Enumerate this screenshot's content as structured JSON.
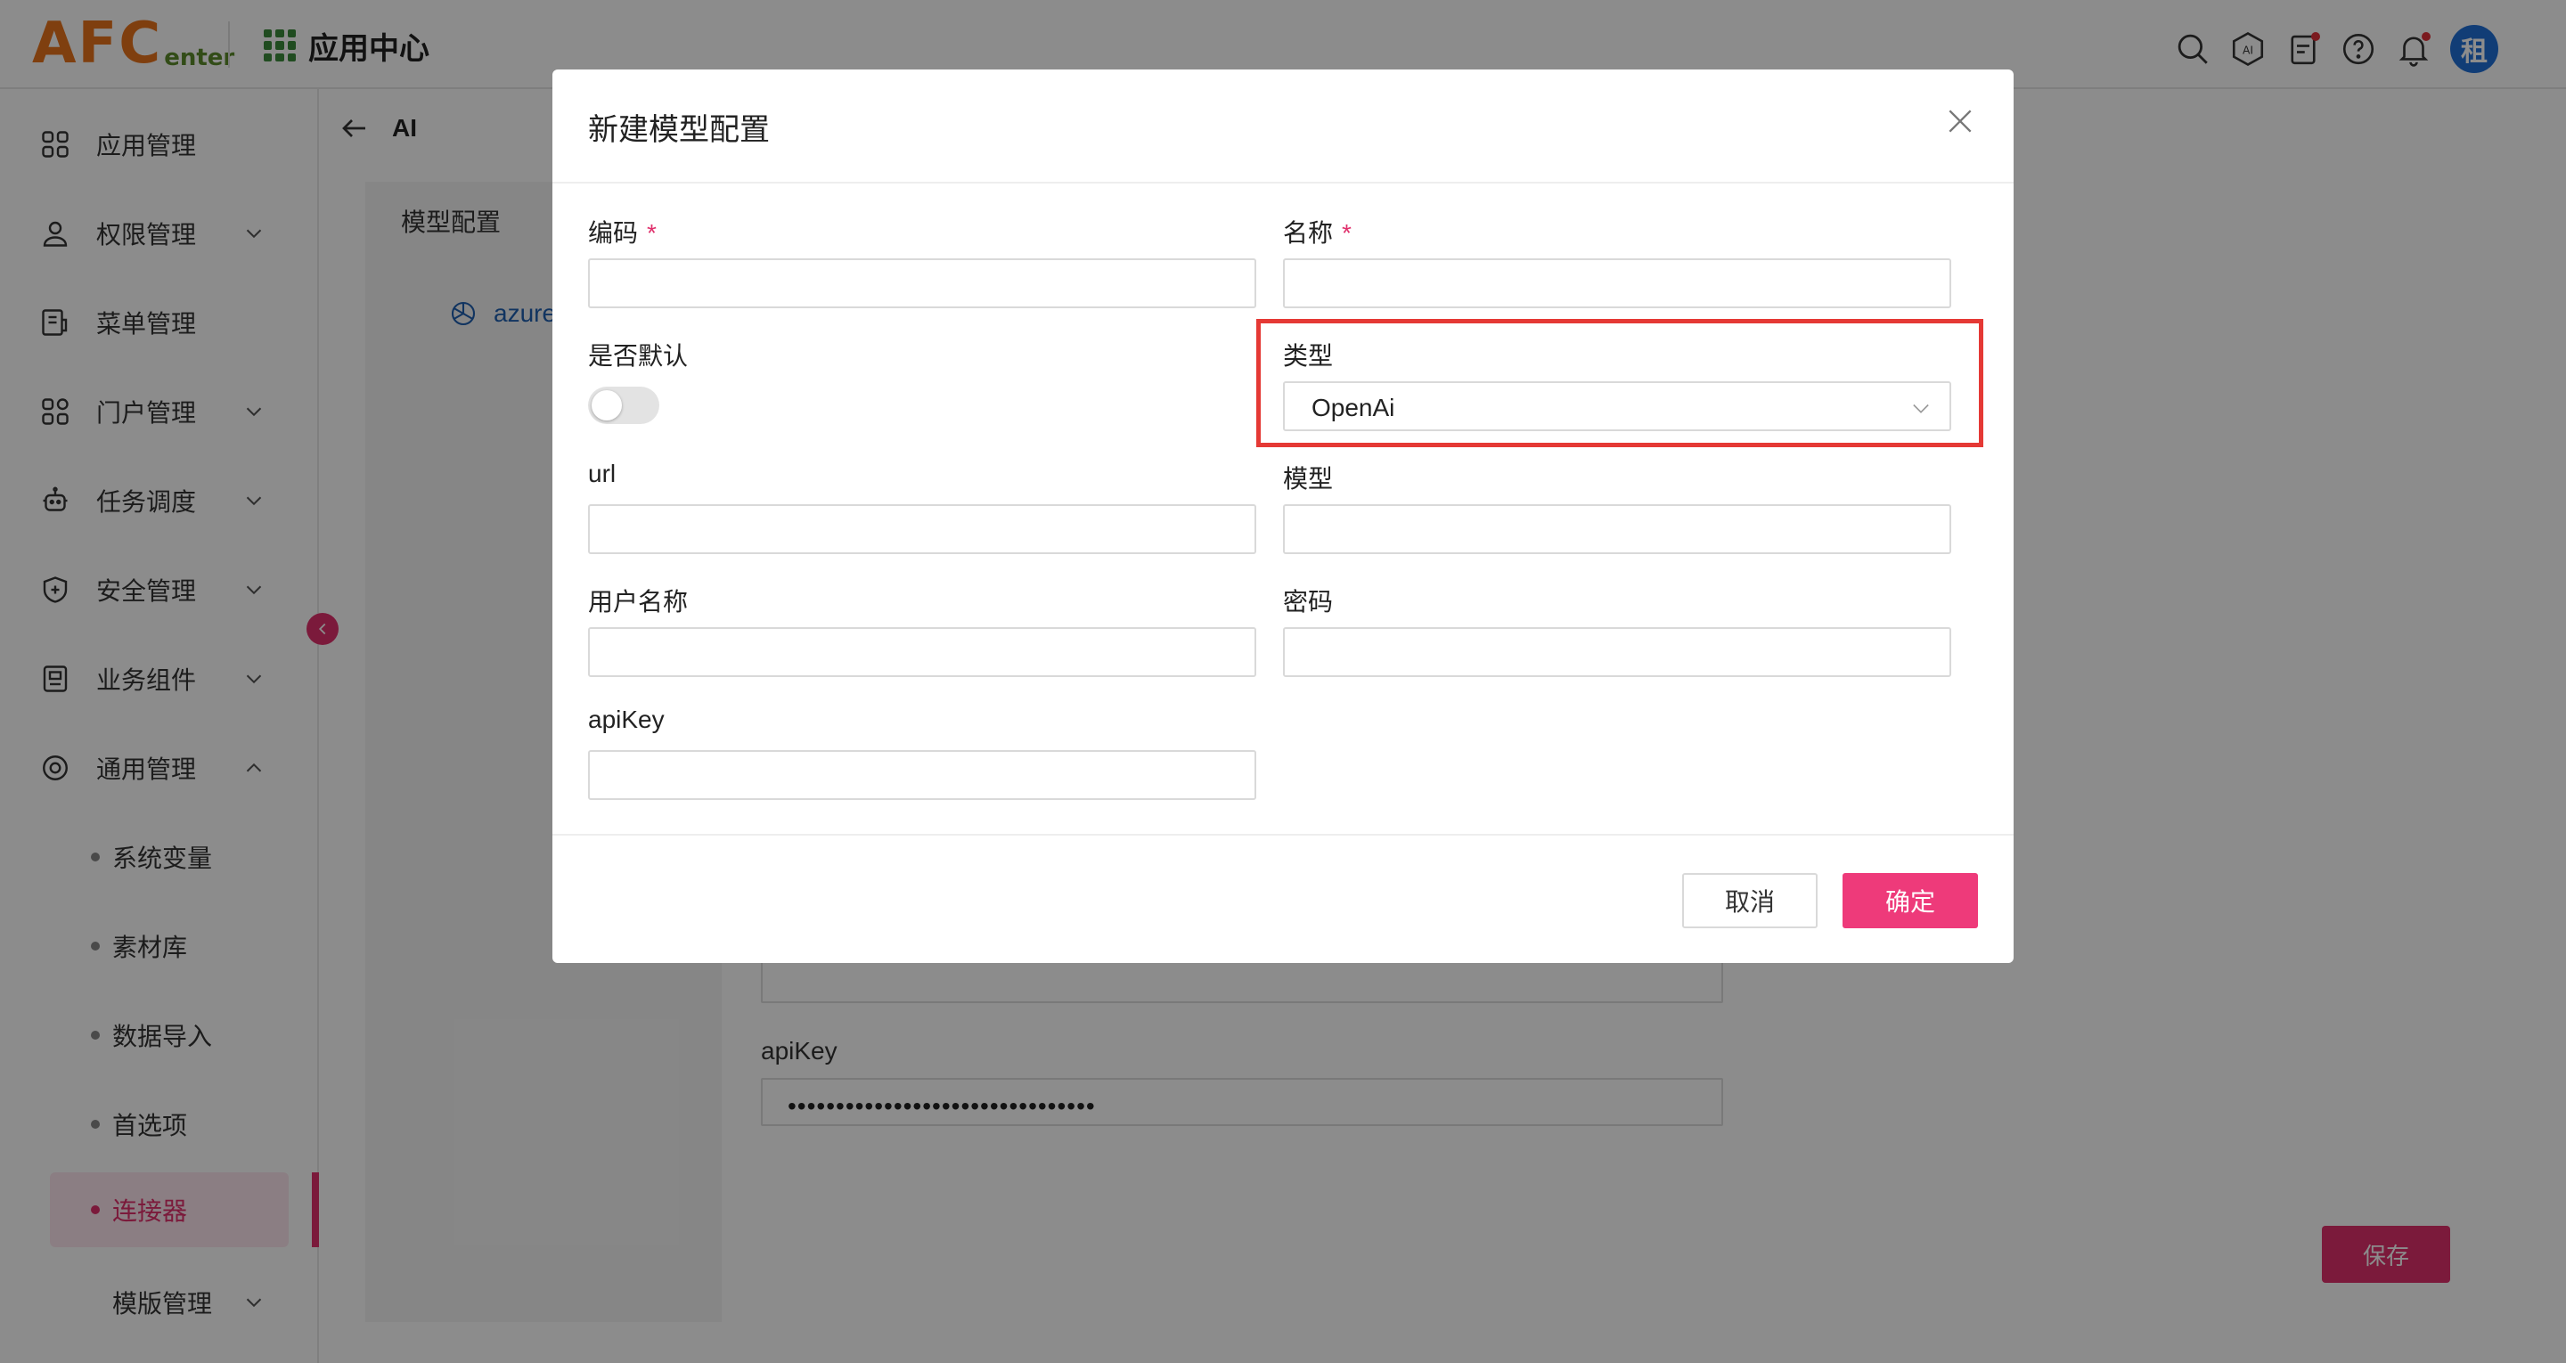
{
  "header": {
    "logo_main": "AFC",
    "logo_sub": "enter",
    "app_center": "应用中心",
    "avatar": "租"
  },
  "sidebar": {
    "items": [
      {
        "label": "应用管理",
        "icon": "apps-icon"
      },
      {
        "label": "权限管理",
        "icon": "user-lock-icon"
      },
      {
        "label": "菜单管理",
        "icon": "menu-list-icon"
      },
      {
        "label": "门户管理",
        "icon": "portal-icon"
      },
      {
        "label": "任务调度",
        "icon": "robot-icon"
      },
      {
        "label": "安全管理",
        "icon": "shield-icon"
      },
      {
        "label": "业务组件",
        "icon": "component-icon"
      },
      {
        "label": "通用管理",
        "icon": "settings-icon"
      }
    ],
    "sub_items": [
      {
        "label": "系统变量"
      },
      {
        "label": "素材库"
      },
      {
        "label": "数据导入"
      },
      {
        "label": "首选项"
      },
      {
        "label": "连接器"
      },
      {
        "label": "模版管理"
      }
    ]
  },
  "page": {
    "title": "AI",
    "panel_title": "模型配置",
    "list_item": "azure",
    "apikey_label": "apiKey",
    "apikey_value": "••••••••••••••••••••••••••••••••",
    "save": "保存"
  },
  "modal": {
    "title": "新建模型配置",
    "fields": {
      "code": {
        "label": "编码",
        "required": "*",
        "value": ""
      },
      "name": {
        "label": "名称",
        "required": "*",
        "value": ""
      },
      "is_default": {
        "label": "是否默认",
        "value": "off"
      },
      "type": {
        "label": "类型",
        "value": "OpenAi"
      },
      "url": {
        "label": "url",
        "value": ""
      },
      "model": {
        "label": "模型",
        "value": ""
      },
      "username": {
        "label": "用户名称",
        "value": ""
      },
      "password": {
        "label": "密码",
        "value": ""
      },
      "apikey": {
        "label": "apiKey",
        "value": ""
      }
    },
    "cancel": "取消",
    "ok": "确定"
  },
  "colors": {
    "accent": "#e0306c",
    "highlight": "#e53935",
    "logo_orange": "#e8731c",
    "logo_green": "#5b8a2a",
    "avatar_blue": "#1f6fd8"
  }
}
